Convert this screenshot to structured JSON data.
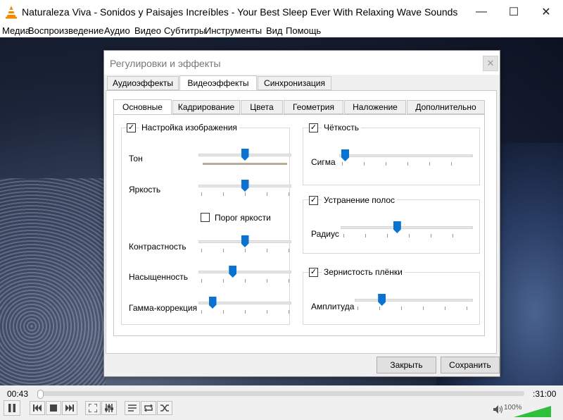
{
  "window": {
    "title": "Naturaleza Viva - Sonidos y Paisajes Increíbles - Your Best Sleep Ever With Relaxing Wave Sounds, Deep ...",
    "minimize_glyph": "—",
    "maximize_glyph": "☐",
    "close_glyph": "✕"
  },
  "menu": [
    "Медиа",
    "Воспроизведение",
    "Аудио",
    "Видео",
    "Субтитры",
    "Инструменты",
    "Вид",
    "Помощь"
  ],
  "dialog": {
    "title": "Регулировки и эффекты",
    "close_glyph": "✕",
    "main_tabs": [
      "Аудиоэффекты",
      "Видеоэффекты",
      "Синхронизация"
    ],
    "active_main_tab": "Видеоэффекты",
    "sub_tabs": [
      "Основные",
      "Кадрирование",
      "Цвета",
      "Геометрия",
      "Наложение",
      "Дополнительно"
    ],
    "active_sub_tab": "Основные",
    "image_adjust": {
      "label": "Настройка изображения",
      "checked": true,
      "hue_label": "Тон",
      "hue_value": 0.5,
      "brightness_label": "Яркость",
      "brightness_value": 0.5,
      "brightness_threshold_label": "Порог яркости",
      "brightness_threshold_checked": false,
      "contrast_label": "Контрастность",
      "contrast_value": 0.5,
      "saturation_label": "Насыщенность",
      "saturation_value": 0.35,
      "gamma_label": "Гамма-коррекция",
      "gamma_value": 0.1
    },
    "sharpen": {
      "label": "Чёткость",
      "checked": true,
      "sigma_label": "Сигма",
      "sigma_value": 0.0
    },
    "debanding": {
      "label": "Устранение полос",
      "checked": true,
      "radius_label": "Радиус",
      "radius_value": 0.42
    },
    "film_grain": {
      "label": "Зернистость плёнки",
      "checked": true,
      "amplitude_label": "Амплитуда",
      "amplitude_value": 0.2
    },
    "close_button": "Закрыть",
    "save_button": "Сохранить"
  },
  "player": {
    "time_current": "00:43",
    "time_total": ":31:00",
    "progress": 0.0,
    "volume_percent": "100%",
    "volume_level": 1.0,
    "icons": [
      "pause-icon",
      "previous-icon",
      "stop-icon",
      "next-icon",
      "fullscreen-icon",
      "extended-settings-icon",
      "playlist-icon",
      "loop-icon",
      "shuffle-icon",
      "speaker-icon"
    ]
  },
  "colors": {
    "accent": "#0a72d1",
    "volume": "#2fbf3a",
    "vlc_orange": "#f28b00"
  }
}
